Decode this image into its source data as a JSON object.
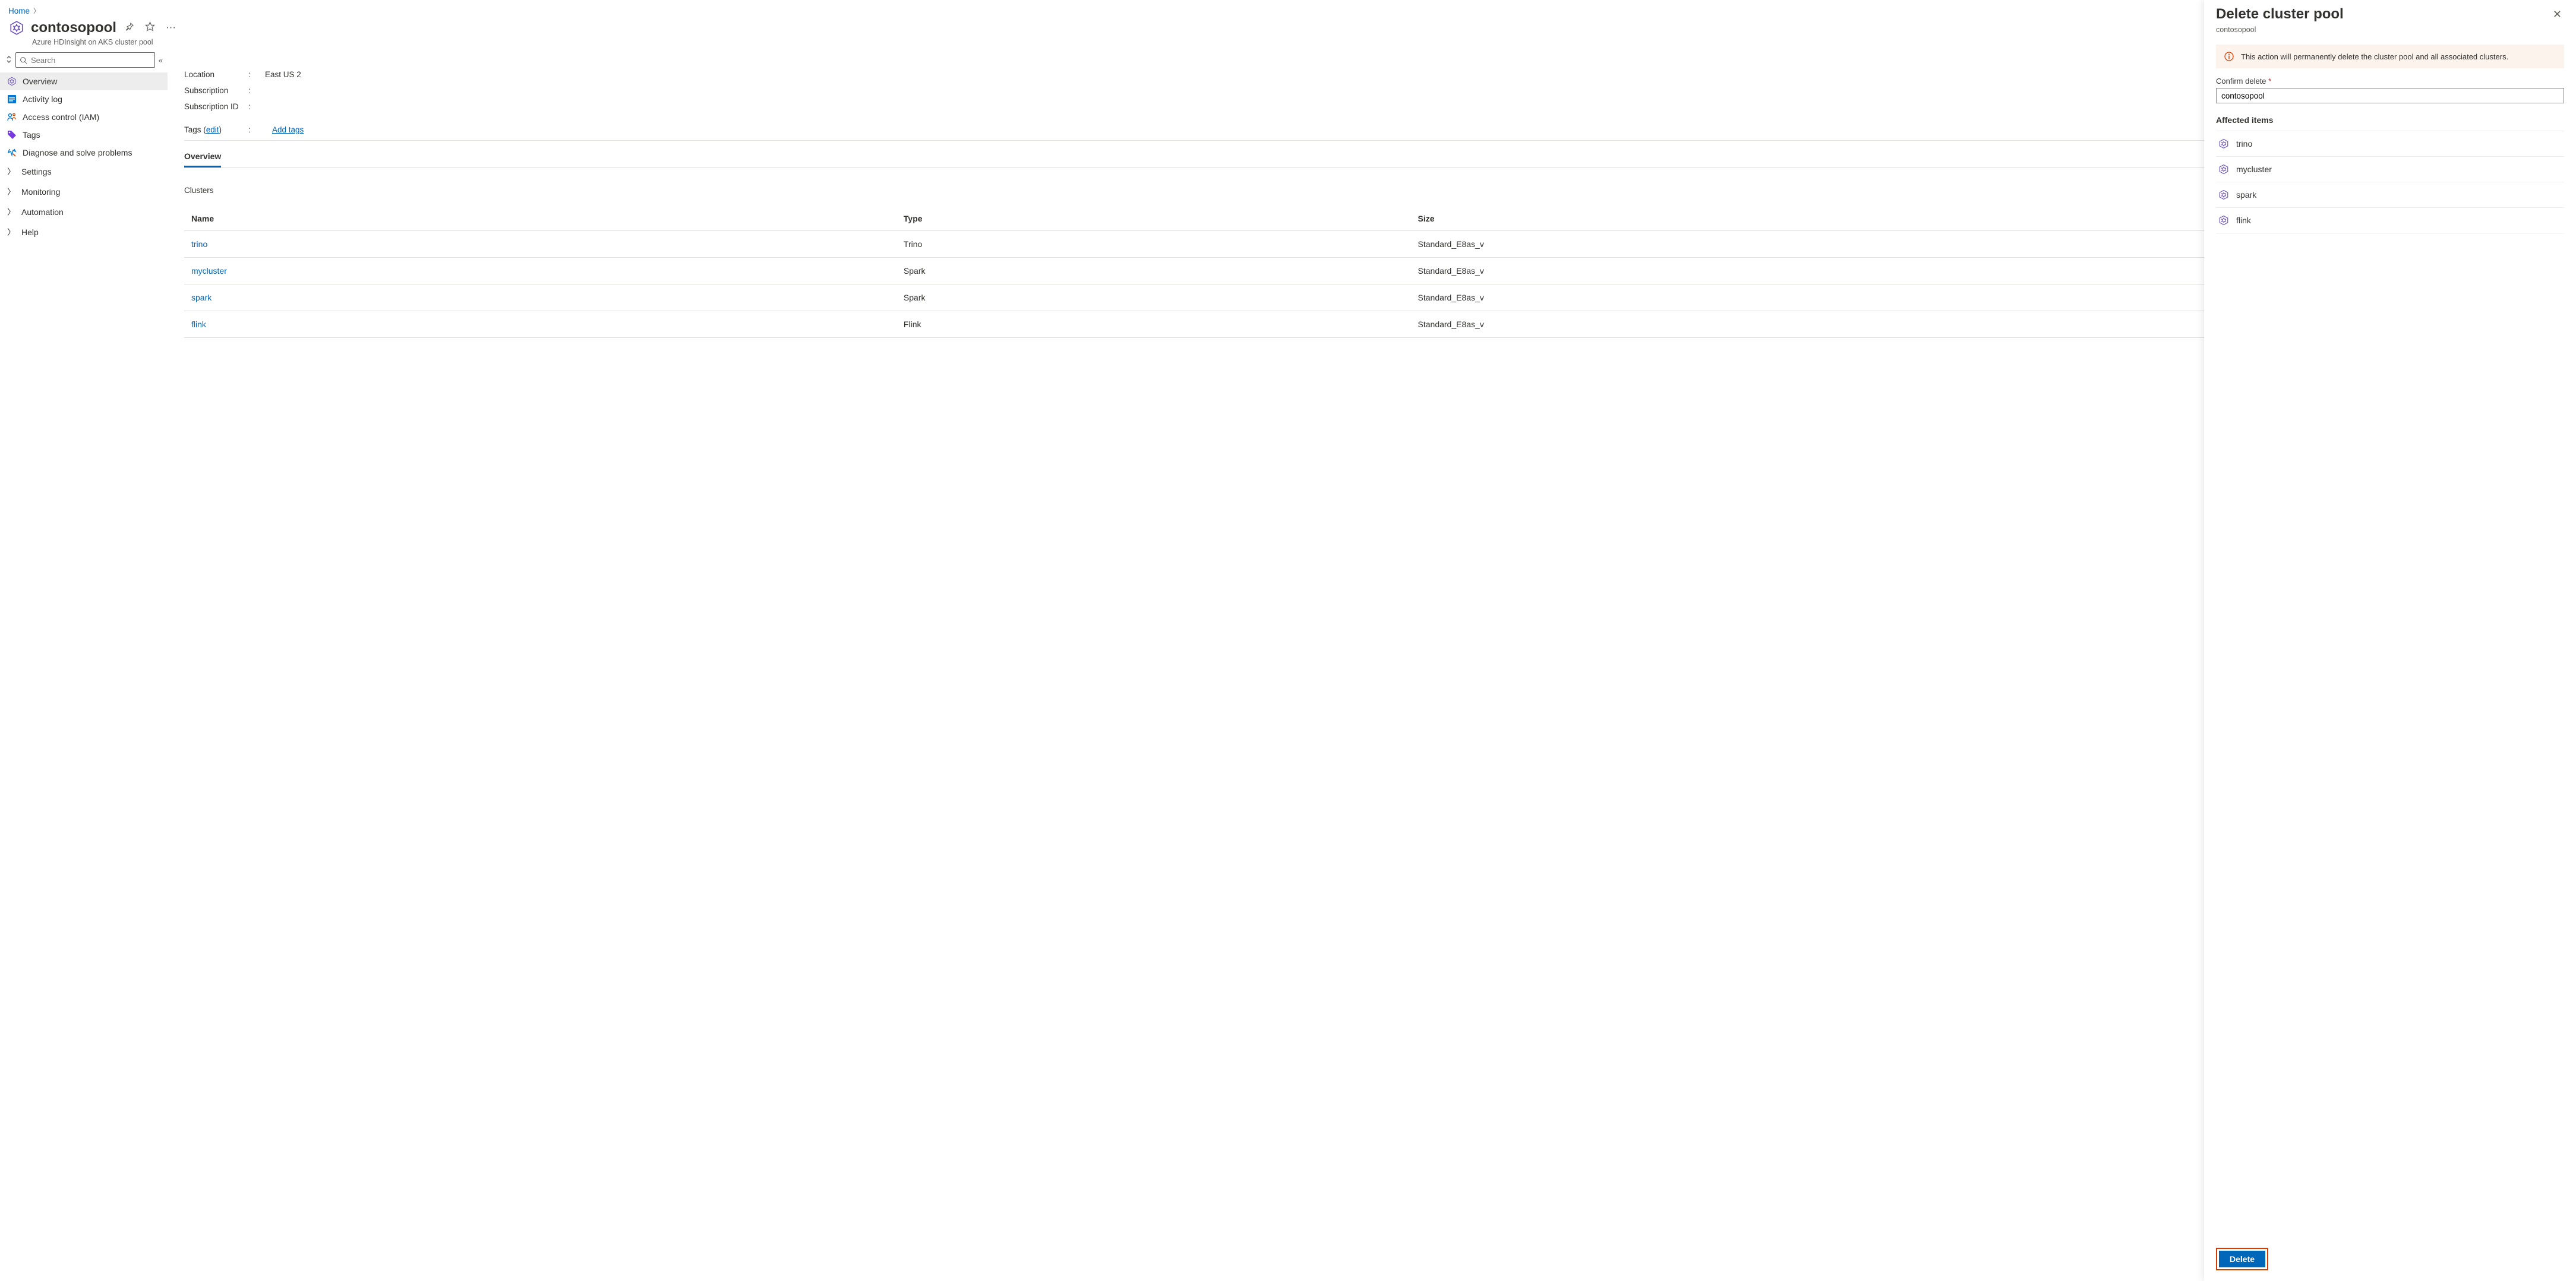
{
  "breadcrumb": {
    "home": "Home"
  },
  "header": {
    "title": "contosopool",
    "subtitle": "Azure HDInsight on AKS cluster pool"
  },
  "search": {
    "placeholder": "Search"
  },
  "sidebar": {
    "items": [
      {
        "label": "Overview"
      },
      {
        "label": "Activity log"
      },
      {
        "label": "Access control (IAM)"
      },
      {
        "label": "Tags"
      },
      {
        "label": "Diagnose and solve problems"
      },
      {
        "label": "Settings"
      },
      {
        "label": "Monitoring"
      },
      {
        "label": "Automation"
      },
      {
        "label": "Help"
      }
    ]
  },
  "props": {
    "location_label": "Location",
    "location_value": "East US 2",
    "subscription_label": "Subscription",
    "subscription_value": "",
    "subscription_id_label": "Subscription ID",
    "subscription_id_value": "",
    "tags_label": "Tags (",
    "tags_edit": "edit",
    "tags_close": ")",
    "add_tags": "Add tags"
  },
  "overview_tab": "Overview",
  "clusters_label": "Clusters",
  "table": {
    "headers": {
      "name": "Name",
      "type": "Type",
      "size": "Size"
    },
    "rows": [
      {
        "name": "trino",
        "type": "Trino",
        "size": "Standard_E8as_v"
      },
      {
        "name": "mycluster",
        "type": "Spark",
        "size": "Standard_E8as_v"
      },
      {
        "name": "spark",
        "type": "Spark",
        "size": "Standard_E8as_v"
      },
      {
        "name": "flink",
        "type": "Flink",
        "size": "Standard_E8as_v"
      }
    ]
  },
  "panel": {
    "title": "Delete cluster pool",
    "subtitle": "contosopool",
    "warning": "This action will permanently delete the cluster pool and all associated clusters.",
    "confirm_label": "Confirm delete",
    "confirm_value": "contosopool",
    "affected_title": "Affected items",
    "items": [
      {
        "name": "trino"
      },
      {
        "name": "mycluster"
      },
      {
        "name": "spark"
      },
      {
        "name": "flink"
      }
    ],
    "delete_label": "Delete"
  }
}
